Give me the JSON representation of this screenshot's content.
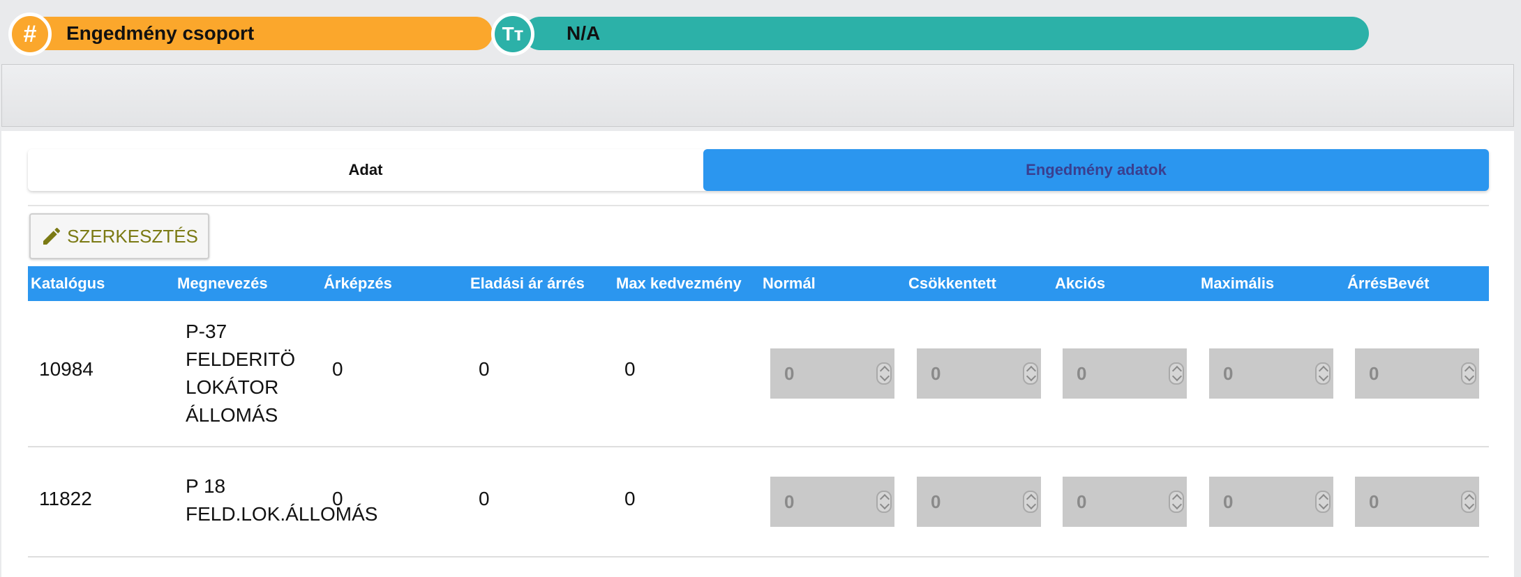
{
  "header": {
    "group_label": "Engedmény csoport",
    "group_icon": "hash-icon",
    "group_icon_glyph": "#",
    "value_label": "N/A",
    "value_icon": "text-type-icon",
    "value_icon_glyph": "Tт",
    "colors": {
      "orange": "#fba72c",
      "teal": "#2cb1a8",
      "blue": "#2b96ef"
    }
  },
  "tabs": [
    {
      "label": "Adat"
    },
    {
      "label": "Engedmény adatok"
    }
  ],
  "edit_button": {
    "label": "SZERKESZTÉS",
    "icon": "pencil-icon"
  },
  "table": {
    "columns": [
      "Katalógus",
      "Megnevezés",
      "Árképzés",
      "Eladási ár árrés",
      "Max kedvezmény",
      "Normál",
      "Csökkentett",
      "Akciós",
      "Maximális",
      "ÁrrésBevét"
    ],
    "rows": [
      {
        "katalogus": "10984",
        "megnevezes": [
          "P-37",
          "FELDERITÖ",
          "LOKÁTOR",
          "ÁLLOMÁS"
        ],
        "arkepzes": "0",
        "eladasi_ar_arres": "0",
        "max_kedvezmeny": "0",
        "inputs": [
          "0",
          "0",
          "0",
          "0",
          "0"
        ]
      },
      {
        "katalogus": "11822",
        "megnevezes": [
          "P 18",
          "FELD.LOK.ÁLLOMÁS"
        ],
        "arkepzes": "0",
        "eladasi_ar_arres": "0",
        "max_kedvezmeny": "0",
        "inputs": [
          "0",
          "0",
          "0",
          "0",
          "0"
        ]
      }
    ]
  }
}
